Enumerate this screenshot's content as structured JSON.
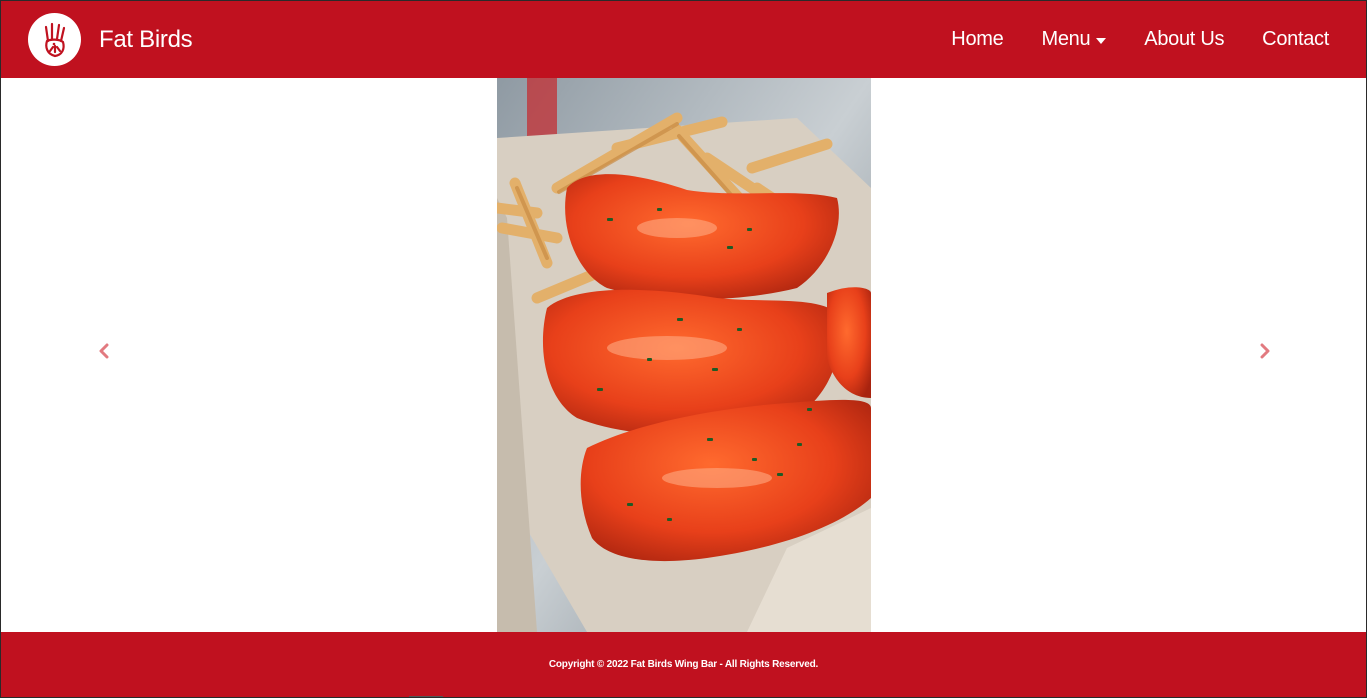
{
  "brand": {
    "name": "Fat Birds",
    "logo_icon": "chicken-hand-logo-icon"
  },
  "nav": {
    "items": [
      {
        "label": "Home"
      },
      {
        "label": "Menu",
        "has_dropdown": true
      },
      {
        "label": "About Us"
      },
      {
        "label": "Contact"
      }
    ]
  },
  "carousel": {
    "prev_icon": "chevron-left-icon",
    "next_icon": "chevron-right-icon",
    "control_color": "#e27a80"
  },
  "footer": {
    "copyright": "Copyright © 2022 Fat Birds Wing Bar - All Rights Reserved."
  },
  "colors": {
    "brand_red": "#c0111f",
    "background": "#ffffff",
    "text_light": "#ffffff"
  }
}
